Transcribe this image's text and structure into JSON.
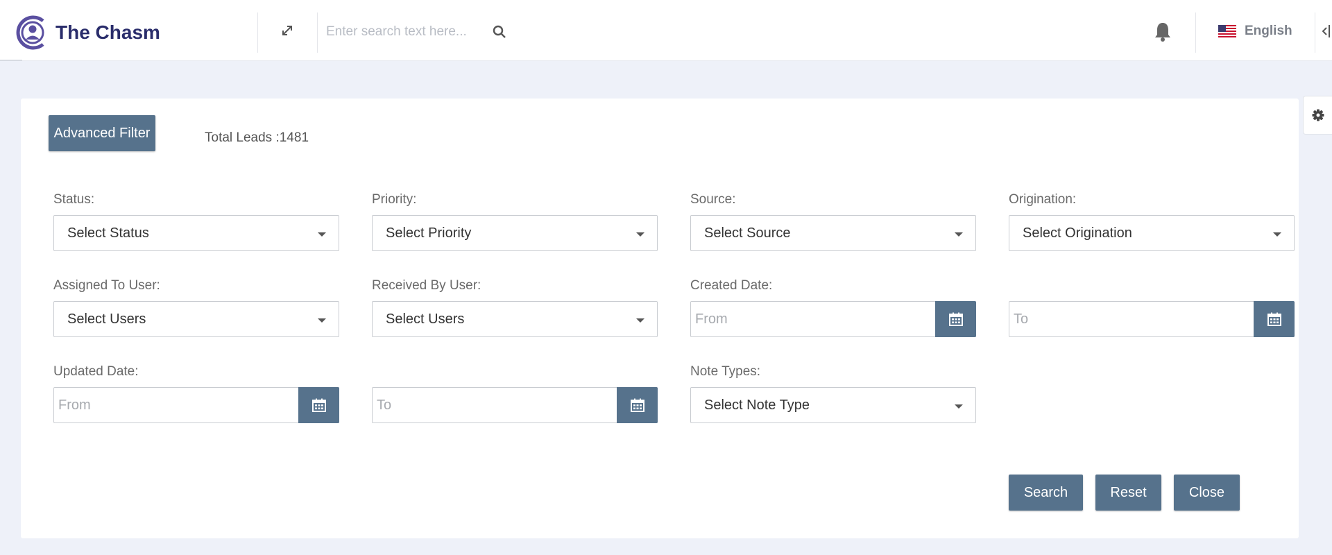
{
  "header": {
    "brand": "The Chasm",
    "search_placeholder": "Enter search text here...",
    "language": "English",
    "icons": [
      "logo-icon",
      "expand-icon",
      "search-icon",
      "bell-icon",
      "us-flag-icon",
      "collapse-icon",
      "gear-icon"
    ]
  },
  "filter": {
    "advanced_filter_label": "Advanced Filter",
    "total_leads": "Total Leads :1481",
    "status": {
      "label": "Status:",
      "value": "Select Status"
    },
    "priority": {
      "label": "Priority:",
      "value": "Select Priority"
    },
    "source": {
      "label": "Source:",
      "value": "Select Source"
    },
    "origination": {
      "label": "Origination:",
      "value": "Select Origination"
    },
    "assigned_to": {
      "label": "Assigned To User:",
      "value": "Select Users"
    },
    "received_by": {
      "label": "Received By User:",
      "value": "Select Users"
    },
    "created_date": {
      "label": "Created Date:",
      "from_placeholder": "From",
      "to_placeholder": "To"
    },
    "updated_date": {
      "label": "Updated Date:",
      "from_placeholder": "From",
      "to_placeholder": "To"
    },
    "note_types": {
      "label": "Note Types:",
      "value": "Select Note Type"
    }
  },
  "actions": {
    "search": "Search",
    "reset": "Reset",
    "close": "Close"
  },
  "colors": {
    "accent": "#56728c",
    "brand": "#2a2d6b",
    "background": "#eef1f9"
  }
}
